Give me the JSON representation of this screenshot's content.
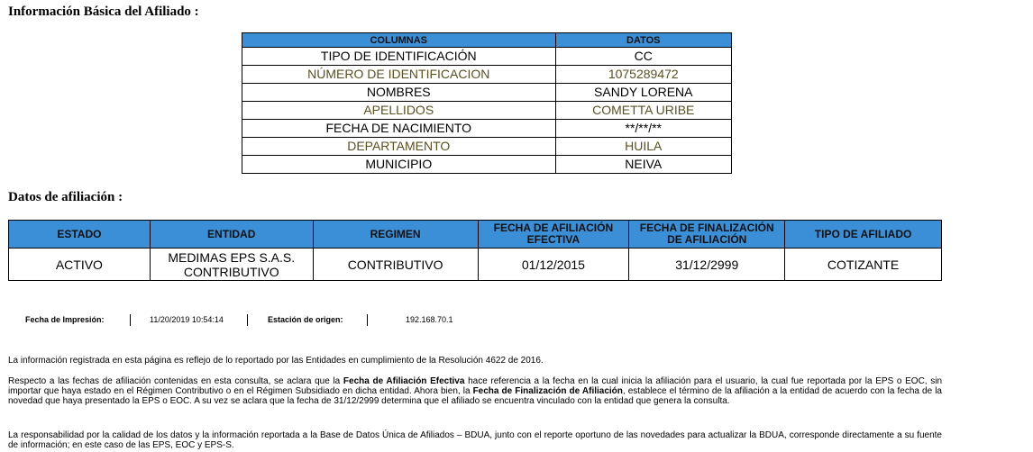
{
  "section_basic_title": "Información Básica del Afiliado :",
  "basic_table": {
    "headers": [
      "COLUMNAS",
      "DATOS"
    ],
    "rows": [
      [
        "TIPO DE IDENTIFICACIÓN",
        "CC"
      ],
      [
        "NÚMERO DE IDENTIFICACION",
        "1075289472"
      ],
      [
        "NOMBRES",
        "SANDY LORENA"
      ],
      [
        "APELLIDOS",
        "COMETTA URIBE"
      ],
      [
        "FECHA DE NACIMIENTO",
        "**/**/**"
      ],
      [
        "DEPARTAMENTO",
        "HUILA"
      ],
      [
        "MUNICIPIO",
        "NEIVA"
      ]
    ]
  },
  "section_afil_title": "Datos de afiliación :",
  "afil_table": {
    "headers": [
      "ESTADO",
      "ENTIDAD",
      "REGIMEN",
      "FECHA DE AFILIACIÓN EFECTIVA",
      "FECHA DE FINALIZACIÓN DE AFILIACIÓN",
      "TIPO DE AFILIADO"
    ],
    "row": [
      "ACTIVO",
      "MEDIMAS EPS S.A.S. CONTRIBUTIVO",
      "CONTRIBUTIVO",
      "01/12/2015",
      "31/12/2999",
      "COTIZANTE"
    ]
  },
  "print_info": {
    "date_label": "Fecha de Impresión:",
    "date_value": "11/20/2019 10:54:14",
    "station_label": "Estación de origen:",
    "station_value": "192.168.70.1"
  },
  "footer": {
    "p1": "La información registrada en esta página es reflejo de lo reportado por las Entidades en cumplimiento de la Resolución 4622 de 2016.",
    "p2_a": "Respecto a las fechas de afiliación contenidas en esta consulta, se aclara que la ",
    "p2_b": "Fecha de Afiliación Efectiva",
    "p2_c": " hace referencia a la fecha en la cual inicia la afiliación para el usuario, la cual fue reportada por la EPS o EOC, sin importar que haya estado en el Régimen Contributivo o en el Régimen Subsidiado en dicha entidad. Ahora bien, la ",
    "p2_d": "Fecha de Finalización de Afiliación",
    "p2_e": ", establece el término de la afiliación a la entidad de acuerdo con la fecha de la novedad que haya presentado la EPS o EOC. A su vez se aclara que la fecha de 31/12/2999 determina que el afiliado se encuentra vinculado con la entidad que genera la consulta.",
    "p3": "La responsabilidad por la calidad de los datos y la información reportada a la Base de Datos Única de Afiliados – BDUA, junto con el reporte oportuno de las novedades para actualizar la BDUA, corresponde directamente a su fuente de información; en este caso de las EPS, EOC y EPS-S."
  }
}
